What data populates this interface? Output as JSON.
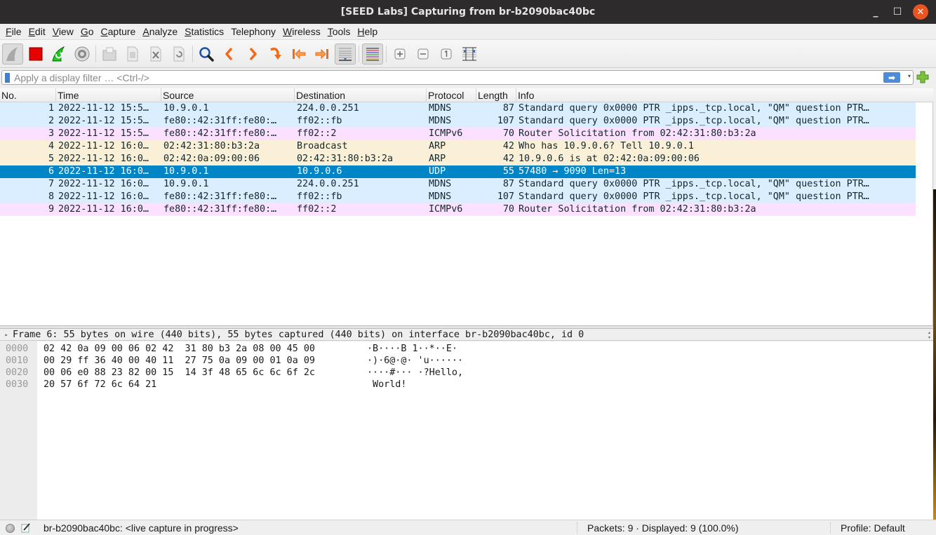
{
  "window": {
    "title": "[SEED Labs] Capturing from br-b2090bac40bc",
    "controls": {
      "minimize": "_",
      "maximize": "☐",
      "close": "✕"
    }
  },
  "menubar": {
    "items": [
      {
        "label": "File",
        "mnemonic": "F",
        "rest": "ile"
      },
      {
        "label": "Edit",
        "mnemonic": "E",
        "rest": "dit"
      },
      {
        "label": "View",
        "mnemonic": "V",
        "rest": "iew"
      },
      {
        "label": "Go",
        "mnemonic": "G",
        "rest": "o"
      },
      {
        "label": "Capture",
        "mnemonic": "C",
        "rest": "apture"
      },
      {
        "label": "Analyze",
        "mnemonic": "A",
        "rest": "nalyze"
      },
      {
        "label": "Statistics",
        "mnemonic": "S",
        "rest": "tatistics"
      },
      {
        "label": "Telephony",
        "mnemonic": "",
        "rest": "Telephony"
      },
      {
        "label": "Wireless",
        "mnemonic": "W",
        "rest": "ireless"
      },
      {
        "label": "Tools",
        "mnemonic": "T",
        "rest": "ools"
      },
      {
        "label": "Help",
        "mnemonic": "H",
        "rest": "elp"
      }
    ]
  },
  "toolbar": {
    "buttons": [
      {
        "name": "start-capture",
        "icon": "shark-fin-icon"
      },
      {
        "name": "stop-capture",
        "icon": "stop-icon"
      },
      {
        "name": "restart-capture",
        "icon": "restart-icon"
      },
      {
        "name": "capture-options",
        "icon": "gear-icon"
      },
      {
        "name": "open-file",
        "icon": "folder-icon"
      },
      {
        "name": "save-file",
        "icon": "file-icon"
      },
      {
        "name": "close-file",
        "icon": "close-file-icon"
      },
      {
        "name": "reload-file",
        "icon": "reload-icon"
      },
      {
        "name": "find-packet",
        "icon": "search-icon"
      },
      {
        "name": "go-previous",
        "icon": "chevron-left-icon"
      },
      {
        "name": "go-next",
        "icon": "chevron-right-icon"
      },
      {
        "name": "go-to-packet",
        "icon": "jump-icon"
      },
      {
        "name": "go-first",
        "icon": "first-icon"
      },
      {
        "name": "go-last",
        "icon": "last-icon"
      },
      {
        "name": "auto-scroll",
        "icon": "autoscroll-icon"
      },
      {
        "name": "colorize",
        "icon": "colorize-icon"
      },
      {
        "name": "zoom-in",
        "icon": "zoom-in-icon"
      },
      {
        "name": "zoom-out",
        "icon": "zoom-out-icon"
      },
      {
        "name": "normal-size",
        "icon": "normal-size-icon"
      },
      {
        "name": "resize-columns",
        "icon": "resize-columns-icon"
      }
    ]
  },
  "filter": {
    "placeholder": "Apply a display filter … <Ctrl-/>",
    "value": "",
    "apply_icon": "➡",
    "dropdown_icon": "▾"
  },
  "packet_list": {
    "columns": [
      "No.",
      "Time",
      "Source",
      "Destination",
      "Protocol",
      "Length",
      "Info"
    ],
    "rows": [
      {
        "no": "1",
        "time": "2022-11-12 15:5…",
        "src": "10.9.0.1",
        "dst": "224.0.0.251",
        "proto": "MDNS",
        "len": "87",
        "info": "Standard query 0x0000 PTR _ipps._tcp.local, \"QM\" question PTR…",
        "color": "mdns",
        "selected": false
      },
      {
        "no": "2",
        "time": "2022-11-12 15:5…",
        "src": "fe80::42:31ff:fe80:…",
        "dst": "ff02::fb",
        "proto": "MDNS",
        "len": "107",
        "info": "Standard query 0x0000 PTR _ipps._tcp.local, \"QM\" question PTR…",
        "color": "mdns",
        "selected": false
      },
      {
        "no": "3",
        "time": "2022-11-12 15:5…",
        "src": "fe80::42:31ff:fe80:…",
        "dst": "ff02::2",
        "proto": "ICMPv6",
        "len": "70",
        "info": "Router Solicitation from 02:42:31:80:b3:2a",
        "color": "icmpv6",
        "selected": false
      },
      {
        "no": "4",
        "time": "2022-11-12 16:0…",
        "src": "02:42:31:80:b3:2a",
        "dst": "Broadcast",
        "proto": "ARP",
        "len": "42",
        "info": "Who has 10.9.0.6? Tell 10.9.0.1",
        "color": "arp",
        "selected": false
      },
      {
        "no": "5",
        "time": "2022-11-12 16:0…",
        "src": "02:42:0a:09:00:06",
        "dst": "02:42:31:80:b3:2a",
        "proto": "ARP",
        "len": "42",
        "info": "10.9.0.6 is at 02:42:0a:09:00:06",
        "color": "arp",
        "selected": false
      },
      {
        "no": "6",
        "time": "2022-11-12 16:0…",
        "src": "10.9.0.1",
        "dst": "10.9.0.6",
        "proto": "UDP",
        "len": "55",
        "info": "57480 → 9090 Len=13",
        "color": "udp-plain",
        "selected": true
      },
      {
        "no": "7",
        "time": "2022-11-12 16:0…",
        "src": "10.9.0.1",
        "dst": "224.0.0.251",
        "proto": "MDNS",
        "len": "87",
        "info": "Standard query 0x0000 PTR _ipps._tcp.local, \"QM\" question PTR…",
        "color": "mdns",
        "selected": false
      },
      {
        "no": "8",
        "time": "2022-11-12 16:0…",
        "src": "fe80::42:31ff:fe80:…",
        "dst": "ff02::fb",
        "proto": "MDNS",
        "len": "107",
        "info": "Standard query 0x0000 PTR _ipps._tcp.local, \"QM\" question PTR…",
        "color": "mdns",
        "selected": false
      },
      {
        "no": "9",
        "time": "2022-11-12 16:0…",
        "src": "fe80::42:31ff:fe80:…",
        "dst": "ff02::2",
        "proto": "ICMPv6",
        "len": "70",
        "info": "Router Solicitation from 02:42:31:80:b3:2a",
        "color": "icmpv6",
        "selected": false
      }
    ],
    "row_colors": {
      "mdns": "#daeeff",
      "icmpv6": "#fce0ff",
      "arp": "#faf0d7",
      "selected": "#0086c7"
    }
  },
  "details": {
    "expand_icon": "▸",
    "line": "Frame 6: 55 bytes on wire (440 bits), 55 bytes captured (440 bits) on interface br-b2090bac40bc, id 0"
  },
  "bytes": {
    "lines": [
      {
        "offset": "0000",
        "hex": "02 42 0a 09 00 06 02 42  31 80 b3 2a 08 00 45 00",
        "ascii": "·B····B 1··*··E·"
      },
      {
        "offset": "0010",
        "hex": "00 29 ff 36 40 00 40 11  27 75 0a 09 00 01 0a 09",
        "ascii": "·)·6@·@· 'u······"
      },
      {
        "offset": "0020",
        "hex": "00 06 e0 88 23 82 00 15  14 3f 48 65 6c 6c 6f 2c",
        "ascii": "····#··· ·?Hello,"
      },
      {
        "offset": "0030",
        "hex": "20 57 6f 72 6c 64 21",
        "ascii": " World!"
      }
    ]
  },
  "statusbar": {
    "left": "br-b2090bac40bc: <live capture in progress>",
    "middle": "Packets: 9 · Displayed: 9 (100.0%)",
    "right": "Profile: Default"
  }
}
